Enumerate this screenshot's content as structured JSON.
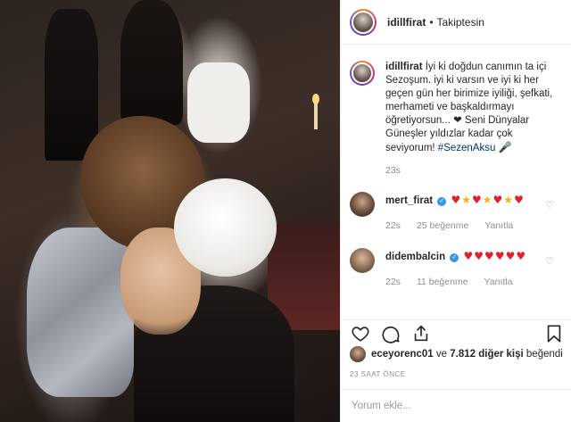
{
  "header": {
    "username": "idillfirat",
    "separator": "•",
    "follow_status": "Takiptesin"
  },
  "caption": {
    "username": "idillfirat",
    "text": "İyi ki doğdun canımın ta içi Sezoşum. iyi ki varsın ve iyi ki her geçen gün her birimize iyiliği, şefkati, merhameti ve başkaldırmayı öğretiyorsun... ❤ Seni Dünyalar Güneşler yıldızlar kadar çok seviyorum! ",
    "hashtag": "#SezenAksu",
    "hashtag_emoji": "🎤",
    "time": "23s"
  },
  "comments": [
    {
      "username": "mert_firat",
      "emojis": [
        {
          "ch": "♥",
          "color": "#e0202a"
        },
        {
          "ch": "★",
          "color": "#f0b619"
        },
        {
          "ch": "♥",
          "color": "#e0202a"
        },
        {
          "ch": "★",
          "color": "#f0b619"
        },
        {
          "ch": "♥",
          "color": "#e0202a"
        },
        {
          "ch": "★",
          "color": "#f0b619"
        },
        {
          "ch": "♥",
          "color": "#e0202a"
        }
      ],
      "time": "22s",
      "likes": "25 beğenme",
      "reply": "Yanıtla"
    },
    {
      "username": "didembalcin",
      "emojis": [
        {
          "ch": "♥",
          "color": "#e0202a"
        },
        {
          "ch": "♥",
          "color": "#e0202a"
        },
        {
          "ch": "♥",
          "color": "#e0202a"
        },
        {
          "ch": "♥",
          "color": "#e0202a"
        },
        {
          "ch": "♥",
          "color": "#e0202a"
        },
        {
          "ch": "♥",
          "color": "#e0202a"
        }
      ],
      "time": "22s",
      "likes": "11 beğenme",
      "reply": "Yanıtla"
    }
  ],
  "likes_line": {
    "user": "eceyorenc01",
    "middle": " ve ",
    "others": "7.812 diğer kişi",
    "suffix": " beğendi"
  },
  "timestamp": "23 SAAT ÖNCE",
  "comment_input": {
    "placeholder": "Yorum ekle..."
  },
  "icons": {
    "like": "heart-outline-icon",
    "comment": "comment-bubble-icon",
    "share": "share-icon",
    "save": "bookmark-icon",
    "comment_like": "small-heart-icon"
  },
  "colors": {
    "verified": "#3897f0",
    "hashtag": "#003569",
    "muted": "#8e8e8e"
  }
}
